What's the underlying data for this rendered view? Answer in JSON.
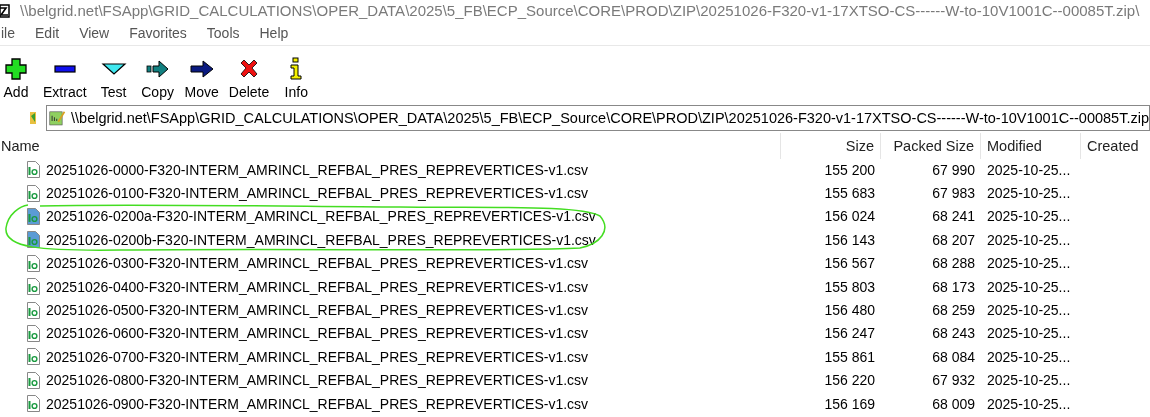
{
  "window": {
    "title": "\\\\belgrid.net\\FSApp\\GRID_CALCULATIONS\\OPER_DATA\\2025\\5_FB\\ECP_Source\\CORE\\PROD\\ZIP\\20251026-F320-v1-17XTSO-CS------W-to-10V1001C--00085T.zip\\"
  },
  "menu": [
    "ile",
    "Edit",
    "View",
    "Favorites",
    "Tools",
    "Help"
  ],
  "toolbar": [
    {
      "kind": "add",
      "label": "Add"
    },
    {
      "kind": "extract",
      "label": "Extract"
    },
    {
      "kind": "test",
      "label": "Test"
    },
    {
      "kind": "copy",
      "label": "Copy"
    },
    {
      "kind": "move",
      "label": "Move"
    },
    {
      "kind": "delete",
      "label": "Delete"
    },
    {
      "kind": "info",
      "label": "Info"
    }
  ],
  "address": "\\\\belgrid.net\\FSApp\\GRID_CALCULATIONS\\OPER_DATA\\2025\\5_FB\\ECP_Source\\CORE\\PROD\\ZIP\\20251026-F320-v1-17XTSO-CS------W-to-10V1001C--00085T.zip",
  "table": {
    "columns": [
      "Name",
      "Size",
      "Packed Size",
      "Modified",
      "Created"
    ],
    "rows": [
      {
        "name": "20251026-0000-F320-INTERM_AMRINCL_REFBAL_PRES_REPREVERTICES-v1.csv",
        "size": "155 200",
        "packed": "67 990",
        "modified": "2025-10-25...",
        "color": "#ffffff"
      },
      {
        "name": "20251026-0100-F320-INTERM_AMRINCL_REFBAL_PRES_REPREVERTICES-v1.csv",
        "size": "155 683",
        "packed": "67 983",
        "modified": "2025-10-25...",
        "color": "#ffffff"
      },
      {
        "name": "20251026-0200a-F320-INTERM_AMRINCL_REFBAL_PRES_REPREVERTICES-v1.csv",
        "size": "156 024",
        "packed": "68 241",
        "modified": "2025-10-25...",
        "color": "#5b9bd5"
      },
      {
        "name": "20251026-0200b-F320-INTERM_AMRINCL_REFBAL_PRES_REPREVERTICES-v1.csv",
        "size": "156 143",
        "packed": "68 207",
        "modified": "2025-10-25...",
        "color": "#5b9bd5"
      },
      {
        "name": "20251026-0300-F320-INTERM_AMRINCL_REFBAL_PRES_REPREVERTICES-v1.csv",
        "size": "156 567",
        "packed": "68 288",
        "modified": "2025-10-25...",
        "color": "#ffffff"
      },
      {
        "name": "20251026-0400-F320-INTERM_AMRINCL_REFBAL_PRES_REPREVERTICES-v1.csv",
        "size": "155 803",
        "packed": "68 173",
        "modified": "2025-10-25...",
        "color": "#ffffff"
      },
      {
        "name": "20251026-0500-F320-INTERM_AMRINCL_REFBAL_PRES_REPREVERTICES-v1.csv",
        "size": "156 480",
        "packed": "68 259",
        "modified": "2025-10-25...",
        "color": "#ffffff"
      },
      {
        "name": "20251026-0600-F320-INTERM_AMRINCL_REFBAL_PRES_REPREVERTICES-v1.csv",
        "size": "156 247",
        "packed": "68 243",
        "modified": "2025-10-25...",
        "color": "#ffffff"
      },
      {
        "name": "20251026-0700-F320-INTERM_AMRINCL_REFBAL_PRES_REPREVERTICES-v1.csv",
        "size": "155 861",
        "packed": "68 084",
        "modified": "2025-10-25...",
        "color": "#ffffff"
      },
      {
        "name": "20251026-0800-F320-INTERM_AMRINCL_REFBAL_PRES_REPREVERTICES-v1.csv",
        "size": "156 220",
        "packed": "67 932",
        "modified": "2025-10-25...",
        "color": "#ffffff"
      },
      {
        "name": "20251026-0900-F320-INTERM_AMRINCL_REFBAL_PRES_REPREVERTICES-v1.csv",
        "size": "156 169",
        "packed": "68 009",
        "modified": "2025-10-25...",
        "color": "#ffffff"
      }
    ]
  }
}
